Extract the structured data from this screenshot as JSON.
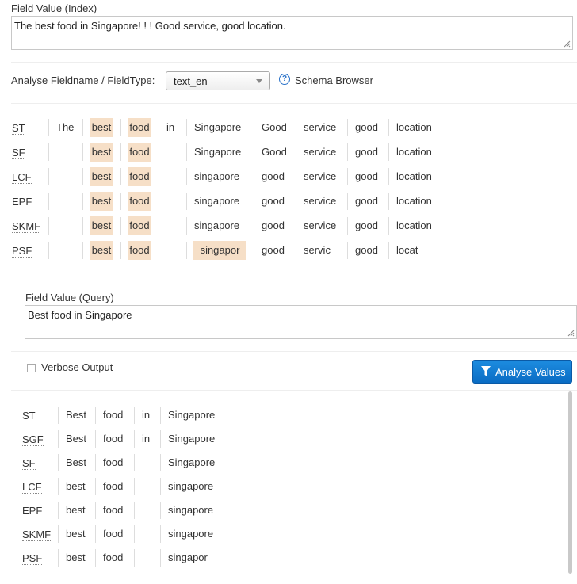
{
  "index": {
    "label": "Field Value (Index)",
    "value": "The best food in Singapore! ! ! Good service, good location."
  },
  "analyse": {
    "label": "Analyse Fieldname / FieldType:",
    "selected": "text_en",
    "schema_browser": "Schema Browser"
  },
  "index_rows": [
    {
      "name": "ST",
      "tokens": [
        "The",
        "best",
        "food",
        "in",
        "Singapore",
        "Good",
        "service",
        "good",
        "location"
      ]
    },
    {
      "name": "SF",
      "tokens": [
        "",
        "best",
        "food",
        "",
        "Singapore",
        "Good",
        "service",
        "good",
        "location"
      ]
    },
    {
      "name": "LCF",
      "tokens": [
        "",
        "best",
        "food",
        "",
        "singapore",
        "good",
        "service",
        "good",
        "location"
      ]
    },
    {
      "name": "EPF",
      "tokens": [
        "",
        "best",
        "food",
        "",
        "singapore",
        "good",
        "service",
        "good",
        "location"
      ]
    },
    {
      "name": "SKMF",
      "tokens": [
        "",
        "best",
        "food",
        "",
        "singapore",
        "good",
        "service",
        "good",
        "location"
      ]
    },
    {
      "name": "PSF",
      "tokens": [
        "",
        "best",
        "food",
        "",
        "singapor",
        "good",
        "servic",
        "good",
        "locat"
      ]
    }
  ],
  "query": {
    "label": "Field Value (Query)",
    "value": "Best food in Singapore"
  },
  "verbose": {
    "label": "Verbose Output",
    "checked": false
  },
  "analyse_button": "Analyse Values",
  "query_rows": [
    {
      "name": "ST",
      "tokens": [
        "Best",
        "food",
        "in",
        "Singapore"
      ]
    },
    {
      "name": "SGF",
      "tokens": [
        "Best",
        "food",
        "in",
        "Singapore"
      ]
    },
    {
      "name": "SF",
      "tokens": [
        "Best",
        "food",
        "",
        "Singapore"
      ]
    },
    {
      "name": "LCF",
      "tokens": [
        "best",
        "food",
        "",
        "singapore"
      ]
    },
    {
      "name": "EPF",
      "tokens": [
        "best",
        "food",
        "",
        "singapore"
      ]
    },
    {
      "name": "SKMF",
      "tokens": [
        "best",
        "food",
        "",
        "singapore"
      ]
    },
    {
      "name": "PSF",
      "tokens": [
        "best",
        "food",
        "",
        "singapor"
      ]
    }
  ],
  "colors": {
    "highlight": "#f6dfc7",
    "button": "#1d8ce0",
    "help": "#2a72c9"
  }
}
